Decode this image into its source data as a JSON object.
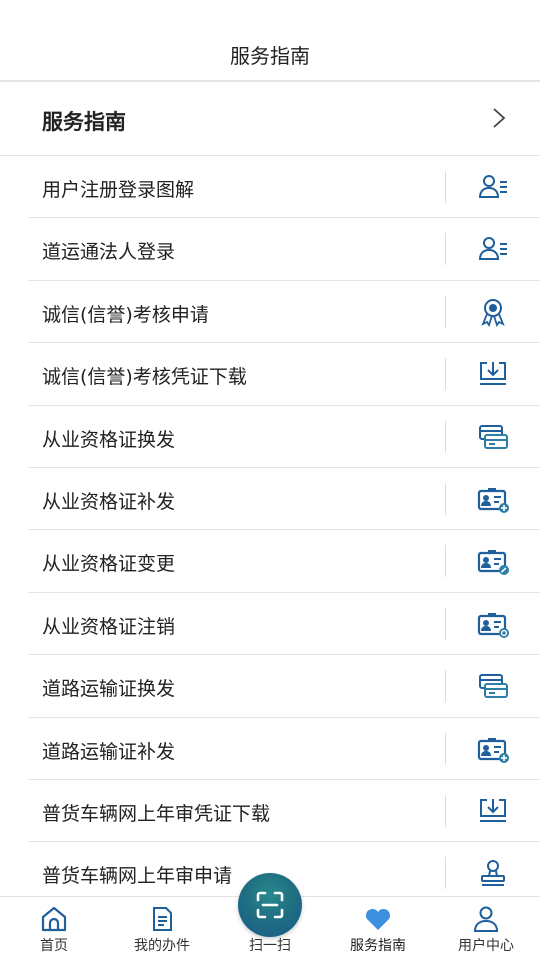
{
  "header": {
    "title": "服务指南"
  },
  "section": {
    "title": "服务指南",
    "chevron_icon": "chevron-right-icon"
  },
  "items": [
    {
      "label": "用户注册登录图解",
      "icon": "person-list-icon"
    },
    {
      "label": "道运通法人登录",
      "icon": "person-list-icon"
    },
    {
      "label": "诚信(信誉)考核申请",
      "icon": "award-medal-icon"
    },
    {
      "label": "诚信(信誉)考核凭证下载",
      "icon": "download-tray-icon"
    },
    {
      "label": "从业资格证换发",
      "icon": "card-exchange-icon"
    },
    {
      "label": "从业资格证补发",
      "icon": "id-card-add-icon"
    },
    {
      "label": "从业资格证变更",
      "icon": "id-card-edit-icon"
    },
    {
      "label": "从业资格证注销",
      "icon": "id-card-cancel-icon"
    },
    {
      "label": "道路运输证换发",
      "icon": "card-exchange-icon"
    },
    {
      "label": "道路运输证补发",
      "icon": "id-card-add-icon"
    },
    {
      "label": "普货车辆网上年审凭证下载",
      "icon": "download-tray-icon"
    },
    {
      "label": "普货车辆网上年审申请",
      "icon": "stamp-icon"
    }
  ],
  "tabbar": {
    "tabs": [
      {
        "label": "首页",
        "icon": "home-icon"
      },
      {
        "label": "我的办件",
        "icon": "document-icon"
      },
      {
        "label": "扫一扫",
        "icon": "scan-icon"
      },
      {
        "label": "服务指南",
        "icon": "heart-icon",
        "active": true
      },
      {
        "label": "用户中心",
        "icon": "user-icon"
      }
    ]
  },
  "colors": {
    "accent": "#1f5f9c",
    "icon_teal": "#2e7fa6",
    "heart": "#3d8fe0",
    "scan_button": "#1f6f82"
  }
}
